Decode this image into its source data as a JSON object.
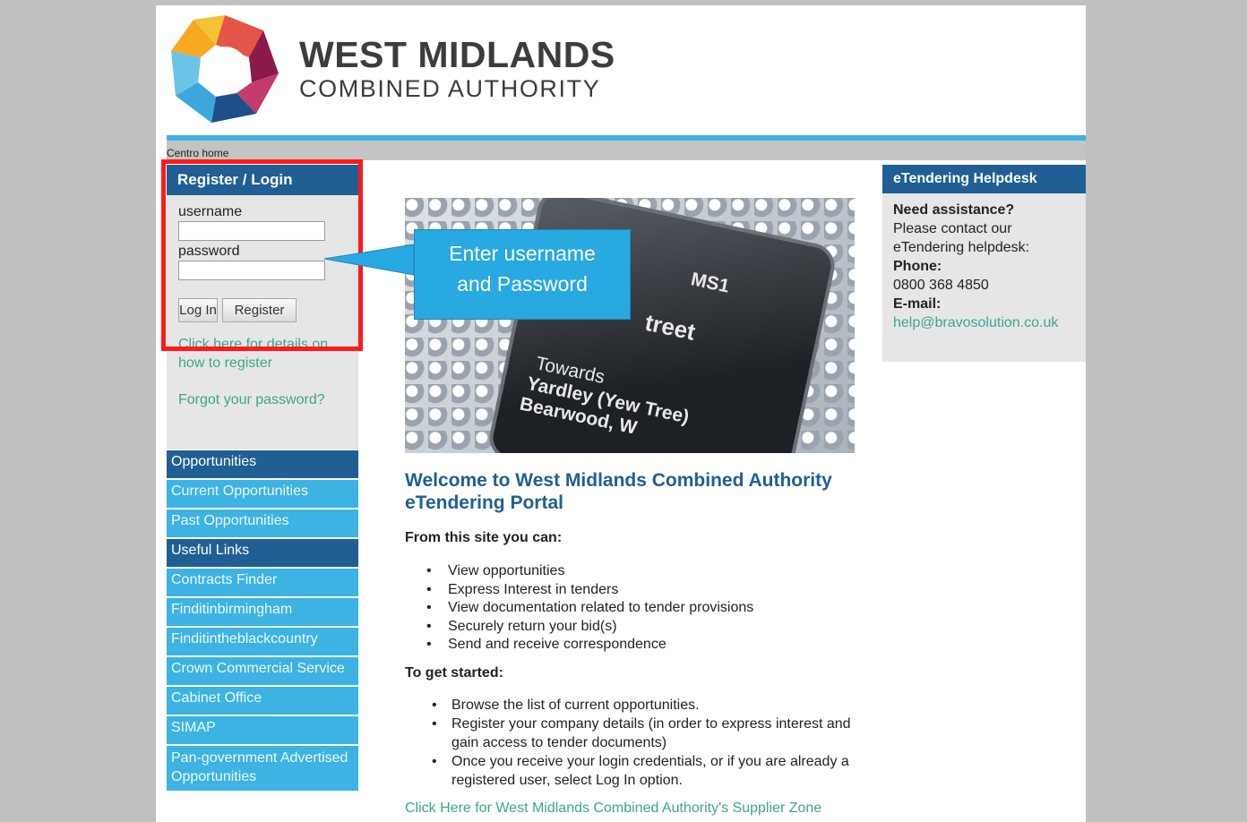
{
  "logo": {
    "title": "WEST MIDLANDS",
    "subtitle": "COMBINED AUTHORITY"
  },
  "breadcrumb": "Centro home",
  "login": {
    "heading": "Register / Login",
    "username_label": "username",
    "password_label": "password",
    "login_button": "Log In",
    "register_button": "Register",
    "register_details_link": "Click here for details on how to register",
    "forgot_link": "Forgot your password?"
  },
  "nav": {
    "opportunities_heading": "Opportunities",
    "current": "Current Opportunities",
    "past": "Past Opportunities",
    "useful_heading": "Useful Links",
    "contracts_finder": "Contracts Finder",
    "finditinbirmingham": "Finditinbirmingham",
    "finditintheblackcountry": "Finditintheblackcountry",
    "crown": "Crown Commercial Service",
    "cabinet": "Cabinet Office",
    "simap": "SIMAP",
    "pan_gov": "Pan-government Advertised Opportunities"
  },
  "hero": {
    "ms1": "MS1",
    "street": "treet",
    "towards": "Towards",
    "yardley": "Yardley (Yew Tree)",
    "bearwood": "Bearwood, W"
  },
  "callout": {
    "line1": "Enter username",
    "line2": "and Password"
  },
  "welcome": {
    "title_line1": "Welcome to West Midlands Combined Authority",
    "title_line2": "eTendering Portal",
    "from_site": "From this site you can:",
    "items": [
      "View opportunities",
      "Express Interest in tenders",
      "View documentation related to tender provisions",
      "Securely return your bid(s)",
      "Send and receive correspondence"
    ],
    "get_started": "To get started:",
    "step1": "Browse the list of current opportunities.",
    "step2": "Register your company details (in order to express interest and gain access to tender documents)",
    "step3": "Once you receive your login credentials, or if you are already a registered user, select Log In option.",
    "supplier_link": "Click Here for West Midlands Combined Authority's Supplier Zone"
  },
  "helpdesk": {
    "heading": "eTendering Helpdesk",
    "need": "Need assistance?",
    "contact": "Please contact our eTendering helpdesk:",
    "phone_label": "Phone:",
    "phone": "0800 368 4850",
    "email_label": "E-mail:",
    "email": "help@bravosolution.co.uk"
  },
  "colors": {
    "navy": "#1f5f94",
    "sky": "#3cb3e3",
    "link_green": "#3aa68f",
    "highlight_red": "#ff1a1a"
  }
}
